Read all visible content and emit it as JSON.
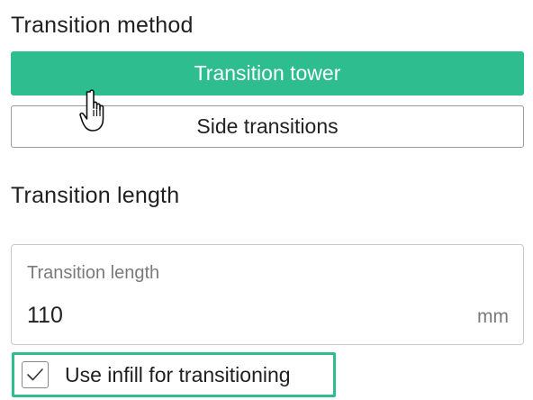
{
  "transition_method": {
    "title": "Transition method",
    "options": [
      {
        "label": "Transition tower",
        "selected": true
      },
      {
        "label": "Side transitions",
        "selected": false
      }
    ]
  },
  "transition_length": {
    "title": "Transition length",
    "field": {
      "label": "Transition length",
      "value": "110",
      "unit": "mm"
    }
  },
  "use_infill": {
    "label": "Use infill for transitioning",
    "checked": true
  },
  "colors": {
    "accent": "#2dbd8e",
    "border": "#9a9a9a"
  },
  "icons": {
    "cursor": "hand-pointer-icon",
    "check": "checkmark-icon"
  }
}
